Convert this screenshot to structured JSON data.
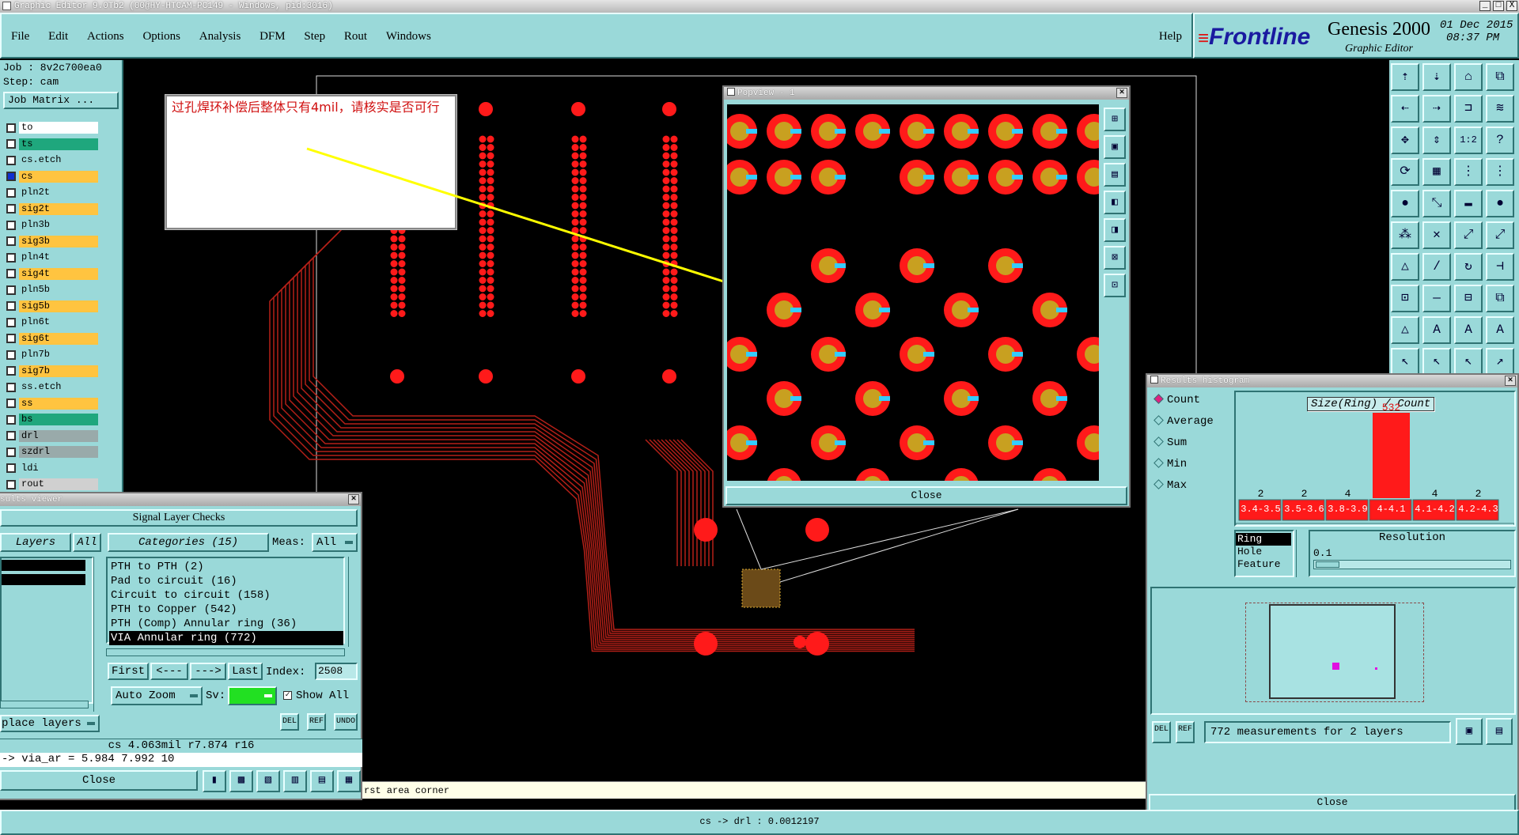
{
  "titlebar": {
    "text": "Graphic Editor 9.0Tb2 (00@HY-HTCAM-PC149 - Windows, pid:3016)",
    "controls": [
      "_",
      "□",
      "X"
    ]
  },
  "menu": [
    "File",
    "Edit",
    "Actions",
    "Options",
    "Analysis",
    "DFM",
    "Step",
    "Rout",
    "Windows"
  ],
  "help": "Help",
  "brand": {
    "logo": "Frontline",
    "product": "Genesis 2000",
    "sub": "Graphic Editor",
    "date": "01 Dec 2015",
    "time": "08:37 PM"
  },
  "job": {
    "job_label": "Job : 8v2c700ea0",
    "step_label": "Step: cam",
    "matrix_button": "Job Matrix ..."
  },
  "layers": [
    {
      "name": "to",
      "color": "#ffffff"
    },
    {
      "name": "ts",
      "color": "#1fa77d"
    },
    {
      "name": "cs.etch",
      "color": "#9ad9d9"
    },
    {
      "name": "cs",
      "color": "#ffc440"
    },
    {
      "name": "pln2t",
      "color": "#9ad9d9"
    },
    {
      "name": "sig2t",
      "color": "#ffc440"
    },
    {
      "name": "pln3b",
      "color": "#9ad9d9"
    },
    {
      "name": "sig3b",
      "color": "#ffc440"
    },
    {
      "name": "pln4t",
      "color": "#9ad9d9"
    },
    {
      "name": "sig4t",
      "color": "#ffc440"
    },
    {
      "name": "pln5b",
      "color": "#9ad9d9"
    },
    {
      "name": "sig5b",
      "color": "#ffc440"
    },
    {
      "name": "pln6t",
      "color": "#9ad9d9"
    },
    {
      "name": "sig6t",
      "color": "#ffc440"
    },
    {
      "name": "pln7b",
      "color": "#9ad9d9"
    },
    {
      "name": "sig7b",
      "color": "#ffc440"
    },
    {
      "name": "ss.etch",
      "color": "#9ad9d9"
    },
    {
      "name": "ss",
      "color": "#ffc440"
    },
    {
      "name": "bs",
      "color": "#1fa77d"
    },
    {
      "name": "drl",
      "color": "#9aa"
    },
    {
      "name": "szdrl",
      "color": "#9aa"
    },
    {
      "name": "ldi",
      "color": "#9ad9d9"
    },
    {
      "name": "rout",
      "color": "#d0d0d0"
    }
  ],
  "annotation": {
    "text": "过孔焊环补偿后整体只有4mil，请核实是否可行"
  },
  "popview": {
    "title": "Popview - 1",
    "close": "Close"
  },
  "histogram": {
    "title": "Results histogram",
    "modes": [
      "Count",
      "Average",
      "Sum",
      "Min",
      "Max"
    ],
    "selected_mode": "Count",
    "chart_title": "Size(Ring) / Count",
    "peak_label": "532",
    "bins": [
      "3.4-3.5",
      "3.5-3.6",
      "3.8-3.9",
      "4-4.1",
      "4.1-4.2",
      "4.2-4.3"
    ],
    "counts": [
      2,
      2,
      4,
      532,
      4,
      2
    ],
    "kinds": [
      "Ring",
      "Hole",
      "Feature"
    ],
    "resolution_label": "Resolution",
    "resolution_value": "0.1",
    "summary": "772 measurements for 2 layers",
    "close": "Close",
    "del": "DEL",
    "ref": "REF"
  },
  "results_viewer": {
    "title": "sults viewer",
    "heading": "Signal Layer Checks",
    "layers_tab": "Layers",
    "all_tab": "All",
    "categories_tab": "Categories (15)",
    "meas_label": "Meas:",
    "meas_value": "All",
    "categories": [
      "PTH to PTH (2)",
      "Pad to circuit (16)",
      "Circuit to circuit (158)",
      "PTH to Copper (542)",
      "PTH (Comp) Annular ring (36)",
      "VIA Annular ring (772)"
    ],
    "selected_category": 5,
    "nav": [
      "First",
      "<---",
      "--->",
      "Last"
    ],
    "index_label": "Index:",
    "index_value": "2508",
    "auto_zoom": "Auto Zoom",
    "sv_label": "Sv:",
    "show_all": "Show All",
    "place_layers": "place layers",
    "meas_line": "cs 4.063mil  r7.874  r16",
    "via_line": "-> via_ar = 5.984 7.992 10",
    "close": "Close",
    "del": "DEL",
    "ref": "REF",
    "undo": "UNDO"
  },
  "prompt": "rst area corner",
  "status": "cs -> drl : 0.0012197",
  "colors": {
    "teal": "#9ad9d9",
    "dark_teal": "#2f7373",
    "pad_red": "#ff1a1a",
    "ring_gold": "#c8a020",
    "trace": "#b52018",
    "accent_cyan": "#33ccff",
    "arrow": "#ffff00"
  }
}
